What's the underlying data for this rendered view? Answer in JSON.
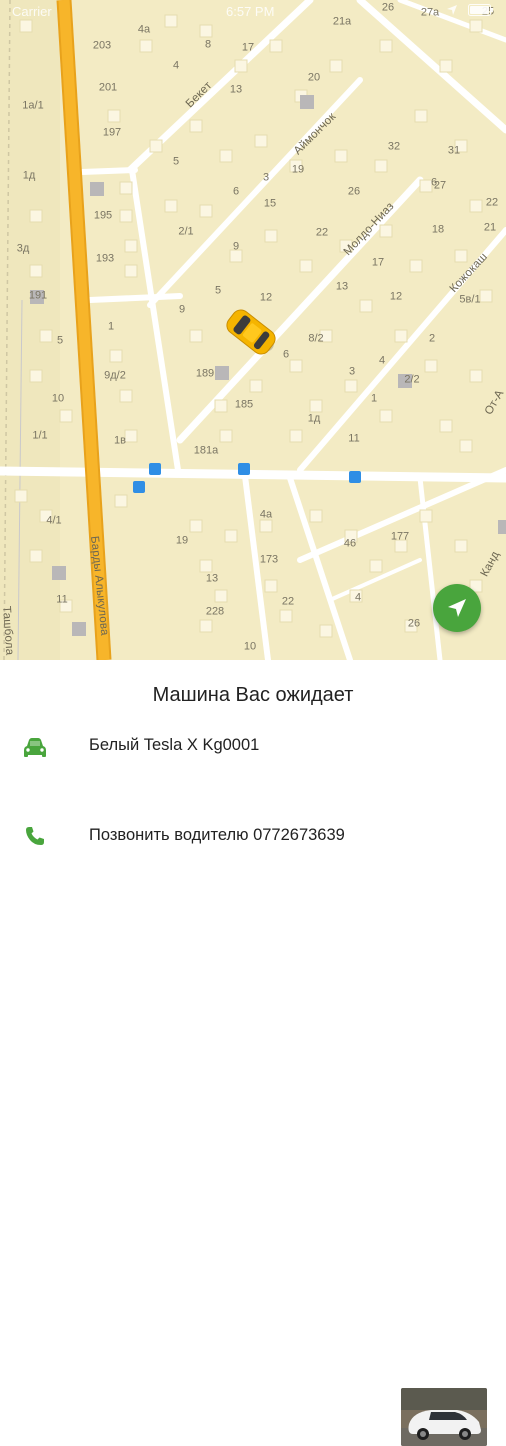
{
  "status_bar": {
    "carrier": "Carrier",
    "time": "6:57 PM"
  },
  "map": {
    "streets": [
      "Бекет",
      "Аймончок",
      "Молдо-Ниаз",
      "Кожокаш",
      "От-А",
      "Барды Алыкулова",
      "Ташбола",
      "Канд"
    ],
    "house_numbers": [
      "26",
      "27а",
      "25",
      "21а",
      "4а",
      "8",
      "203",
      "4",
      "17",
      "201",
      "13",
      "20",
      "1а/1",
      "197",
      "5",
      "6",
      "19",
      "32",
      "31",
      "1д",
      "26",
      "195",
      "3",
      "6",
      "2/1",
      "15",
      "27",
      "22",
      "193",
      "9",
      "22",
      "21",
      "3д",
      "18",
      "5",
      "12",
      "13",
      "17",
      "12",
      "5в/1",
      "191",
      "1",
      "9",
      "8/2",
      "5",
      "6",
      "2",
      "189",
      "9д/2",
      "4",
      "10",
      "3",
      "2/2",
      "1",
      "1д",
      "185",
      "1/1",
      "1в",
      "11",
      "181а",
      "4/1",
      "19",
      "46",
      "177",
      "4а",
      "13",
      "173",
      "11",
      "228",
      "4",
      "10",
      "22",
      "26"
    ],
    "fab_icon": "navigation-arrow-icon"
  },
  "sheet": {
    "title": "Машина Вас ожидает",
    "car_icon": "car-icon",
    "car_description": "Белый Tesla X Kg0001",
    "call_icon": "phone-icon",
    "call_text": "Позвонить водителю 0772673639"
  },
  "colors": {
    "accent": "#49a53d",
    "map_bg": "#f3ebc4",
    "main_road": "#f7b52a",
    "taxi": "#f5b400"
  }
}
